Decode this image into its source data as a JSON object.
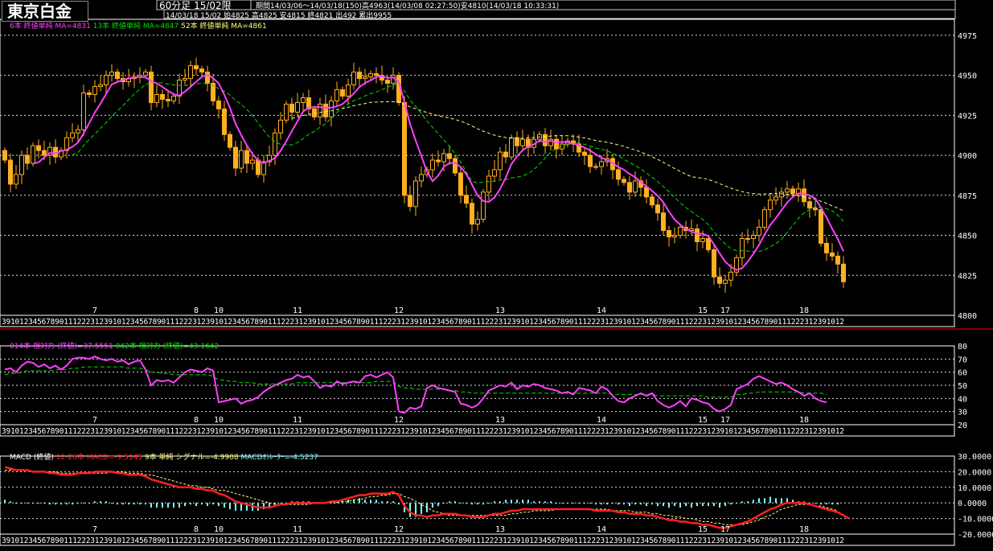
{
  "header": {
    "title": "東京白金",
    "period": "60分足 15/02限",
    "range": "期間14/03/06〜14/03/18(150)",
    "high": "高4963(14/03/08 02:27:50)",
    "low": "安4810(14/03/18 10:33:31)",
    "quote_date": "14/03/18 15/02",
    "open": "始4825",
    "high2": "高4825",
    "low2": "安4815",
    "close": "終4821",
    "volume": "出492",
    "cumulative": "累出9955"
  },
  "legends": {
    "ma6": "6本 終値単純 MA=4831",
    "ma13": "13本 終値単純 MA=4847",
    "ma52": "52本 終値単純 MA=4861",
    "rsi14": "014本 相対力 (終値)=37.5551",
    "rsi42": "042本 相対力 (終値)=43.1642",
    "macd_label": "MACD (終値)",
    "macd_line": "12-26本 MACD=-9.5145",
    "signal": "9本 単純 シグナル=-4.9908",
    "osc": "MACDｵｼﾚｰﾀｰ=-4.5237"
  },
  "colors": {
    "candle": "#ffb020",
    "ma6": "#ff40ff",
    "ma13": "#00e000",
    "ma52": "#ffff80",
    "rsi14": "#ff40ff",
    "rsi42": "#00e000",
    "macd": "#ff2020",
    "signal": "#ffff80",
    "histogram": "#80ffff",
    "separator": "#ff0000"
  },
  "chart_data": [
    {
      "type": "candlestick",
      "title": "東京白金 60分足",
      "ylim": [
        4800,
        4985
      ],
      "yticks": [
        4975,
        4950,
        4925,
        4900,
        4875,
        4850,
        4825,
        4800
      ],
      "date_labels": [
        {
          "label": "7",
          "bar": 16
        },
        {
          "label": "8",
          "bar": 34
        },
        {
          "label": "10",
          "bar": 38
        },
        {
          "label": "11",
          "bar": 52
        },
        {
          "label": "12",
          "bar": 70
        },
        {
          "label": "13",
          "bar": 88
        },
        {
          "label": "14",
          "bar": 106
        },
        {
          "label": "15",
          "bar": 124
        },
        {
          "label": "17",
          "bar": 128
        },
        {
          "label": "18",
          "bar": 142
        }
      ],
      "hour_ticks": "3910123456789011122231239101234567890111222312391012345678901112223123910123456789011122231239101234567890111222312391012345678901112223123910123456789011122231239101234567890111222312391012",
      "close": [
        4897,
        4882,
        4888,
        4900,
        4895,
        4906,
        4903,
        4900,
        4905,
        4899,
        4903,
        4911,
        4914,
        4916,
        4939,
        4938,
        4943,
        4944,
        4950,
        4952,
        4948,
        4946,
        4948,
        4949,
        4950,
        4952,
        4933,
        4938,
        4935,
        4934,
        4937,
        4947,
        4948,
        4956,
        4954,
        4952,
        4945,
        4934,
        4929,
        4913,
        4905,
        4892,
        4903,
        4895,
        4897,
        4888,
        4896,
        4900,
        4914,
        4922,
        4932,
        4927,
        4933,
        4936,
        4929,
        4924,
        4932,
        4924,
        4934,
        4941,
        4937,
        4944,
        4952,
        4948,
        4949,
        4951,
        4950,
        4947,
        4945,
        4950,
        4933,
        4875,
        4868,
        4884,
        4888,
        4891,
        4897,
        4896,
        4901,
        4898,
        4889,
        4875,
        4870,
        4857,
        4860,
        4877,
        4887,
        4891,
        4902,
        4899,
        4911,
        4906,
        4910,
        4905,
        4910,
        4913,
        4906,
        4910,
        4904,
        4907,
        4909,
        4907,
        4902,
        4900,
        4893,
        4893,
        4896,
        4898,
        4891,
        4885,
        4883,
        4877,
        4884,
        4880,
        4874,
        4869,
        4864,
        4853,
        4849,
        4850,
        4855,
        4853,
        4854,
        4846,
        4848,
        4841,
        4824,
        4820,
        4822,
        4827,
        4836,
        4848,
        4848,
        4850,
        4855,
        4866,
        4872,
        4874,
        4877,
        4879,
        4876,
        4879,
        4871,
        4867,
        4866,
        4845,
        4839,
        4837,
        4832,
        4821
      ]
    },
    {
      "type": "line",
      "title": "相対力",
      "ylim": [
        20,
        80
      ],
      "yticks": [
        80,
        70,
        60,
        50,
        40,
        30,
        20
      ],
      "series": [
        {
          "name": "014本 相対力 (終値)",
          "values": [
            62,
            63,
            60,
            65,
            68,
            67,
            64,
            66,
            63,
            65,
            62,
            65,
            70,
            71,
            71,
            70,
            72,
            70,
            69,
            70,
            68,
            69,
            66,
            68,
            69,
            62,
            50,
            54,
            53,
            54,
            52,
            56,
            60,
            62,
            61,
            60,
            63,
            61,
            37,
            38,
            39,
            40,
            36,
            38,
            39,
            41,
            45,
            48,
            50,
            52,
            54,
            55,
            58,
            56,
            57,
            53,
            48,
            50,
            49,
            53,
            51,
            52,
            53,
            52,
            57,
            58,
            56,
            58,
            60,
            56,
            30,
            29,
            33,
            32,
            34,
            48,
            50,
            48,
            47,
            46,
            45,
            36,
            35,
            33,
            35,
            40,
            46,
            48,
            50,
            49,
            52,
            47,
            50,
            49,
            51,
            50,
            48,
            47,
            46,
            44,
            45,
            43,
            48,
            47,
            46,
            44,
            49,
            47,
            42,
            38,
            37,
            40,
            42,
            44,
            42,
            44,
            38,
            35,
            33,
            35,
            38,
            34,
            40,
            39,
            37,
            36,
            32,
            30,
            32,
            35,
            47,
            49,
            51,
            55,
            57,
            55,
            53,
            51,
            52,
            50,
            47,
            45,
            42,
            44,
            40,
            38,
            37
          ]
        },
        {
          "name": "042本 相対力 (終値)",
          "values": [
            58,
            59,
            59,
            60,
            61,
            61,
            61,
            61,
            61,
            62,
            62,
            62,
            63,
            63,
            64,
            64,
            64,
            64,
            64,
            64,
            64,
            64,
            63,
            63,
            63,
            62,
            60,
            60,
            59,
            59,
            58,
            58,
            58,
            58,
            58,
            58,
            58,
            57,
            54,
            54,
            53,
            53,
            52,
            52,
            52,
            51,
            51,
            51,
            51,
            51,
            51,
            51,
            52,
            52,
            52,
            52,
            52,
            52,
            52,
            52,
            52,
            52,
            52,
            52,
            52,
            52,
            53,
            53,
            53,
            53,
            49,
            48,
            48,
            47,
            47,
            47,
            47,
            47,
            47,
            46,
            46,
            45,
            45,
            44,
            44,
            44,
            44,
            44,
            44,
            44,
            44,
            44,
            44,
            44,
            44,
            44,
            44,
            44,
            44,
            44,
            44,
            44,
            44,
            44,
            44,
            44,
            44,
            44,
            43,
            43,
            43,
            43,
            43,
            43,
            43,
            43,
            42,
            42,
            42,
            42,
            42,
            42,
            42,
            42,
            42,
            41,
            41,
            41,
            41,
            41,
            43,
            43,
            44,
            44,
            45,
            45,
            45,
            45,
            45,
            45,
            45,
            45,
            44,
            44,
            44,
            44,
            43
          ]
        }
      ]
    },
    {
      "type": "line",
      "title": "MACD (終値)",
      "ylim": [
        -20,
        30
      ],
      "yticks": [
        "30.0000",
        "20.0000",
        "10.0000",
        "0.0000",
        "-10.0000",
        "-20.0000"
      ],
      "series": [
        {
          "name": "12-26本 MACD",
          "values": [
            23,
            22,
            21,
            21,
            21,
            20,
            20,
            20,
            19,
            19,
            18,
            18,
            18,
            19,
            19,
            19,
            20,
            20,
            20,
            20,
            19,
            19,
            18,
            18,
            18,
            17,
            15,
            14,
            13,
            12,
            11,
            10,
            10,
            10,
            9,
            9,
            8,
            8,
            6,
            5,
            3,
            1,
            0,
            -1,
            -2,
            -3,
            -3,
            -3,
            -2,
            -1,
            -1,
            0,
            0,
            0,
            0,
            0,
            0,
            0,
            1,
            1,
            2,
            3,
            4,
            5,
            5,
            6,
            6,
            6,
            6,
            7,
            5,
            -2,
            -6,
            -8,
            -8,
            -9,
            -8,
            -8,
            -7,
            -7,
            -7,
            -8,
            -8,
            -9,
            -9,
            -9,
            -8,
            -7,
            -7,
            -6,
            -5,
            -5,
            -4,
            -4,
            -4,
            -4,
            -4,
            -4,
            -4,
            -4,
            -4,
            -4,
            -4,
            -4,
            -4,
            -5,
            -5,
            -5,
            -5,
            -6,
            -6,
            -7,
            -7,
            -7,
            -8,
            -8,
            -9,
            -10,
            -11,
            -11,
            -12,
            -12,
            -13,
            -13,
            -14,
            -14,
            -15,
            -16,
            -16,
            -15,
            -14,
            -13,
            -12,
            -10,
            -8,
            -6,
            -4,
            -3,
            -1,
            0,
            0,
            0,
            0,
            -1,
            -2,
            -3,
            -4,
            -5,
            -6,
            -8,
            -10
          ]
        },
        {
          "name": "9本 単純 シグナル",
          "values": [
            21,
            21,
            21,
            21,
            21,
            20,
            20,
            20,
            20,
            20,
            19,
            19,
            19,
            19,
            19,
            19,
            19,
            19,
            19,
            20,
            20,
            20,
            19,
            19,
            19,
            18,
            18,
            17,
            16,
            15,
            14,
            13,
            12,
            11,
            11,
            10,
            10,
            9,
            8,
            8,
            7,
            6,
            5,
            4,
            3,
            2,
            1,
            0,
            -1,
            -1,
            -1,
            -1,
            -1,
            -1,
            -1,
            0,
            0,
            0,
            0,
            0,
            1,
            1,
            2,
            2,
            3,
            4,
            4,
            5,
            5,
            6,
            6,
            4,
            3,
            1,
            -1,
            -3,
            -5,
            -6,
            -7,
            -8,
            -8,
            -8,
            -8,
            -8,
            -8,
            -8,
            -8,
            -8,
            -8,
            -8,
            -7,
            -7,
            -6,
            -6,
            -5,
            -5,
            -5,
            -5,
            -4,
            -4,
            -4,
            -4,
            -4,
            -4,
            -4,
            -4,
            -4,
            -4,
            -5,
            -5,
            -5,
            -5,
            -6,
            -6,
            -6,
            -7,
            -7,
            -8,
            -8,
            -9,
            -9,
            -10,
            -10,
            -11,
            -12,
            -12,
            -13,
            -13,
            -14,
            -14,
            -14,
            -14,
            -13,
            -12,
            -11,
            -9,
            -8,
            -6,
            -4,
            -3,
            -2,
            -1,
            -1,
            -1,
            -2,
            -2,
            -3,
            -4,
            -5
          ]
        }
      ]
    }
  ]
}
